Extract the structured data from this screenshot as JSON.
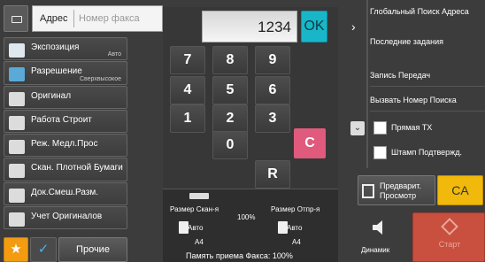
{
  "address": {
    "label": "Адрес",
    "placeholder": "Номер факса"
  },
  "menu": [
    {
      "label": "Экспозиция",
      "sub": "Авто",
      "icon": "exposure-icon"
    },
    {
      "label": "Разрешение",
      "sub": "Сверхвысокое",
      "icon": "resolution-icon"
    },
    {
      "label": "Оригинал",
      "sub": "",
      "icon": "original-icon"
    },
    {
      "label": "Работа Строит",
      "sub": "",
      "icon": "job-build-icon"
    },
    {
      "label": "Реж. Медл.Прос",
      "sub": "",
      "icon": "slow-scan-icon"
    },
    {
      "label": "Скан. Плотной Бумаги",
      "sub": "",
      "icon": "thick-paper-icon"
    },
    {
      "label": "Док.Смеш.Разм.",
      "sub": "",
      "icon": "mixed-size-icon"
    },
    {
      "label": "Учет Оригиналов",
      "sub": "",
      "icon": "original-count-icon"
    }
  ],
  "bottom_left": {
    "other_label": "Прочие"
  },
  "keypad": {
    "display": "1234",
    "ok": "OK",
    "keys": [
      "7",
      "8",
      "9",
      "4",
      "5",
      "6",
      "1",
      "2",
      "3",
      "0",
      "R"
    ],
    "clear": "C"
  },
  "status": {
    "scan_size_label": "Размер Скан-я",
    "scan_size_value": "Авто",
    "scan_size_paper": "A4",
    "ratio": "100%",
    "send_size_label": "Размер Отпр-я",
    "send_size_value": "Авто",
    "send_size_paper": "A4",
    "memory": "Память приема Факса: 100%"
  },
  "right": {
    "global_search": "Глобальный Поиск Адреса",
    "recent_jobs": "Последние задания",
    "record_transfer": "Запись Передач",
    "call_search": "Вызвать Номер Поиска",
    "direct_tx": "Прямая TX",
    "confirm_stamp": "Штамп Подтвержд.",
    "preview": "Предварит. Просмотр",
    "ca": "CA",
    "speaker": "Динамик",
    "start": "Старт"
  }
}
